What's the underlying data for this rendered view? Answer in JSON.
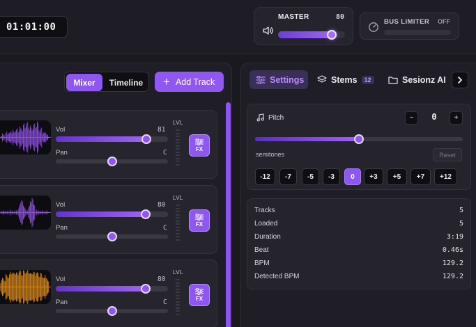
{
  "transport": {
    "timecode": "01:01:00"
  },
  "master": {
    "label": "MASTER",
    "value": "80",
    "level": 0.8
  },
  "bus_limiter": {
    "label": "BUS LIMITER",
    "status": "OFF"
  },
  "view_toggle": {
    "mixer": "Mixer",
    "timeline": "Timeline",
    "active": "Mixer"
  },
  "add_track": {
    "label": "Add Track",
    "icon": "plus-icon"
  },
  "tracks": [
    {
      "vol_label": "Vol",
      "vol_value": "81",
      "pan_label": "Pan",
      "pan_value": "C",
      "lvl_label": "LVL",
      "fx_label": "FX",
      "waveform_color": "#8e4fe0",
      "volume": 0.81,
      "pan": 0.5
    },
    {
      "vol_label": "Vol",
      "vol_value": "80",
      "pan_label": "Pan",
      "pan_value": "C",
      "lvl_label": "LVL",
      "fx_label": "FX",
      "waveform_color": "#8e4fe0",
      "volume": 0.8,
      "pan": 0.5
    },
    {
      "vol_label": "Vol",
      "vol_value": "80",
      "pan_label": "Pan",
      "pan_value": "C",
      "lvl_label": "LVL",
      "fx_label": "FX",
      "waveform_color": "#d98a1c",
      "volume": 0.8,
      "pan": 0.5
    }
  ],
  "tabs": [
    {
      "label": "Settings",
      "icon": "sliders-icon",
      "active": true
    },
    {
      "label": "Stems",
      "icon": "layers-icon",
      "badge": "12"
    },
    {
      "label": "Sesionz AI",
      "icon": "folder-icon"
    }
  ],
  "pitch": {
    "title": "Pitch",
    "value": "0",
    "minus": "−",
    "plus": "+",
    "unit_label": "semitones",
    "reset_label": "Reset",
    "position": 0.5,
    "presets": [
      "-12",
      "-7",
      "-5",
      "-3",
      "0",
      "+3",
      "+5",
      "+7",
      "+12"
    ],
    "active_preset": "0"
  },
  "stats": [
    {
      "key": "Tracks",
      "value": "5"
    },
    {
      "key": "Loaded",
      "value": "5"
    },
    {
      "key": "Duration",
      "value": "3:19"
    },
    {
      "key": "Beat",
      "value": "0.46s"
    },
    {
      "key": "BPM",
      "value": "129.2"
    },
    {
      "key": "Detected BPM",
      "value": "129.2"
    }
  ],
  "colors": {
    "accent": "#8e57f2",
    "background": "#1a1920",
    "panel": "#26252d"
  }
}
